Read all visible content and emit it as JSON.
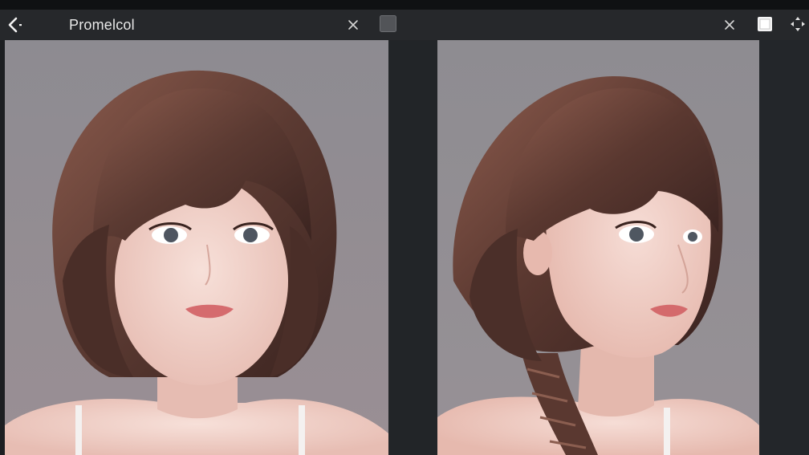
{
  "toolbar": {
    "title": "Promelcol",
    "back_icon": "back-arrow-icon",
    "close_icon": "close-icon",
    "square_icon": "square-icon",
    "window_icon": "window-square-icon",
    "move_icon": "move-arrows-icon"
  },
  "colors": {
    "background": "#1f2124",
    "toolbar": "#26282b",
    "panel_backdrop": "#8c8a90",
    "hair": "#5a3a33",
    "skin": "#f1d2cb"
  }
}
